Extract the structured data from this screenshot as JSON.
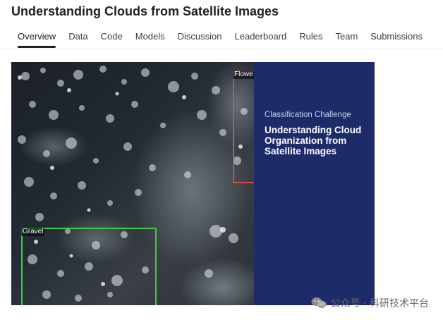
{
  "page": {
    "title": "Understanding Clouds from Satellite Images"
  },
  "tabs": [
    {
      "label": "Overview",
      "active": true
    },
    {
      "label": "Data"
    },
    {
      "label": "Code"
    },
    {
      "label": "Models"
    },
    {
      "label": "Discussion"
    },
    {
      "label": "Leaderboard"
    },
    {
      "label": "Rules"
    },
    {
      "label": "Team"
    },
    {
      "label": "Submissions"
    }
  ],
  "banner": {
    "labels": {
      "flower": "Flowe",
      "gravel": "Gravel"
    },
    "colors": {
      "flower_box": "#e04848",
      "gravel_box": "#3ccf3c",
      "panel_bg": "#1d2b68"
    },
    "panel": {
      "kicker": "Classification Challenge",
      "heading": "Understanding Cloud Organization from Satellite Images"
    }
  },
  "watermark": {
    "icon": "wechat-icon",
    "text": "公众号 · 科研技术平台"
  }
}
